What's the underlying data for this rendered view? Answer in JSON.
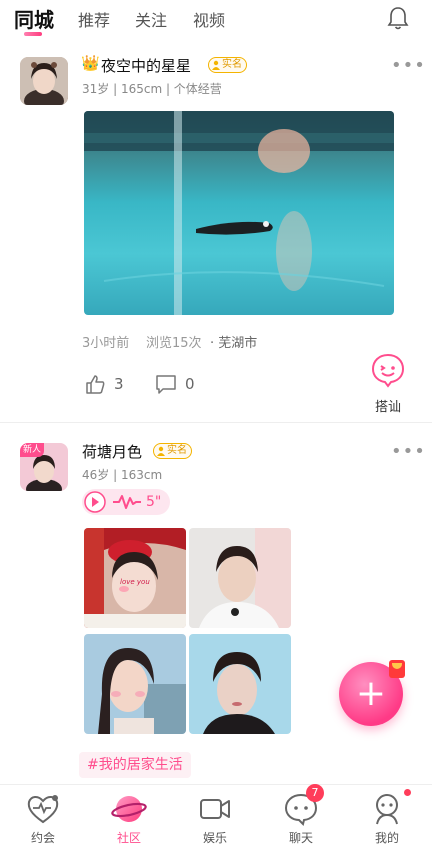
{
  "top_tabs": [
    "同城",
    "推荐",
    "关注",
    "视频"
  ],
  "colors": {
    "accent": "#ff4d8d",
    "badge_gold": "#f4b400"
  },
  "posts": [
    {
      "nickname": "夜空中的星星",
      "crown": "👑",
      "verified": "实名",
      "meta": "31岁 | 165cm | 个体经营",
      "time": "3小时前",
      "views": "浏览15次",
      "city": "· 芜湖市",
      "likes": "3",
      "comments": "0",
      "greet_label": "搭讪"
    },
    {
      "nickname": "荷塘月色",
      "new_tag": "新人",
      "verified": "实名",
      "meta": "46岁 | 163cm",
      "voice_seconds": "5\"",
      "photo_caption": "love you",
      "tag": "#我的居家生活"
    }
  ],
  "fab_label": "+",
  "bottom_nav": [
    {
      "label": "约会",
      "icon": "heart-pulse-icon"
    },
    {
      "label": "社区",
      "icon": "planet-icon"
    },
    {
      "label": "娱乐",
      "icon": "video-camera-icon"
    },
    {
      "label": "聊天",
      "icon": "chat-bubble-icon",
      "badge": "7"
    },
    {
      "label": "我的",
      "icon": "profile-icon"
    }
  ]
}
